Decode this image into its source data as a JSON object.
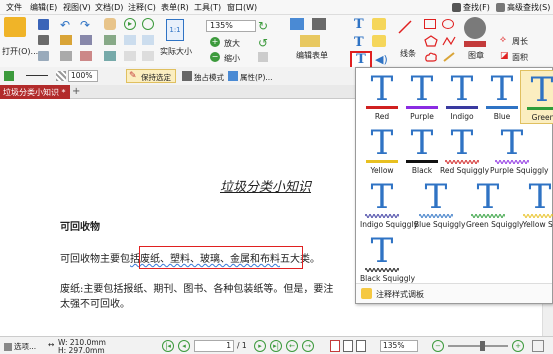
{
  "menubar": {
    "items": [
      "文件",
      "编辑(E)",
      "视图(V)",
      "文档(D)",
      "注释(C)",
      "表单(R)",
      "工具(T)",
      "窗口(W)"
    ],
    "find_label": "查找(F)",
    "advanced_find_label": "高级查找(S)"
  },
  "toolbar": {
    "open_label": "打开(O)...",
    "zoom_value": "135%",
    "actual_size_label": "实际大小",
    "zoom_in_label": "放大",
    "zoom_out_label": "缩小",
    "edit_form_label": "编辑表单",
    "line_label": "线条",
    "shape_label": "图章",
    "perimeter_label": "周长",
    "area_label": "面积"
  },
  "formatbar": {
    "zoom_value": "100%",
    "keep_selected_label": "保持选定",
    "exclusive_mode_label": "独占模式",
    "properties_label": "属性(P)..."
  },
  "tabs": [
    {
      "label": "垃圾分类小知识 *"
    }
  ],
  "document": {
    "title": "垃圾分类小知识",
    "section_heading": "可回收物",
    "para1": {
      "before": "可回收物主要包",
      "highlighted": "括废纸、塑料、玻璃、金属和布料",
      "after": "五大类。"
    },
    "para2_line1": "废纸:主要包括报纸、期刊、图书、各种包装纸等。但是，要注",
    "para2_line2": "太强不可回收。"
  },
  "palette": {
    "swatches": [
      {
        "label": "Red",
        "color": "#d02020",
        "style": "solid",
        "selected": false
      },
      {
        "label": "Purple",
        "color": "#8a2be2",
        "style": "solid",
        "selected": false
      },
      {
        "label": "Indigo",
        "color": "#3a3aa0",
        "style": "solid",
        "selected": false
      },
      {
        "label": "Blue",
        "color": "#2f73c4",
        "style": "solid",
        "selected": false
      },
      {
        "label": "Green",
        "color": "#2e9e3a",
        "style": "solid",
        "selected": true
      },
      {
        "label": "Yellow",
        "color": "#e8c020",
        "style": "solid",
        "selected": false
      },
      {
        "label": "Black",
        "color": "#111111",
        "style": "solid",
        "selected": false
      },
      {
        "label": "Red Squiggly",
        "color": "#d02020",
        "style": "squiggly",
        "selected": false
      },
      {
        "label": "Purple Squiggly",
        "color": "#8a2be2",
        "style": "squiggly",
        "selected": false
      },
      {
        "label": "Indigo Squiggly",
        "color": "#3a3aa0",
        "style": "squiggly",
        "selected": false
      },
      {
        "label": "Blue Squiggly",
        "color": "#2f73c4",
        "style": "squiggly",
        "selected": false
      },
      {
        "label": "Green Squiggly",
        "color": "#2e9e3a",
        "style": "squiggly",
        "selected": false
      },
      {
        "label": "Yellow Sq",
        "color": "#e8c020",
        "style": "squiggly",
        "selected": false
      },
      {
        "label": "Black Squiggly",
        "color": "#111111",
        "style": "squiggly",
        "selected": false
      }
    ],
    "footer_label": "注释样式调板"
  },
  "statusbar": {
    "select_label": "选项...",
    "width": "W: 210.0mm",
    "height": "H: 297.0mm",
    "page_current": "1",
    "page_total": "/ 1",
    "zoom_value": "135%"
  },
  "colors": {
    "accent": "#b22b2b",
    "highlight_box": "#e02020",
    "blue_T": "#2f73c4"
  }
}
